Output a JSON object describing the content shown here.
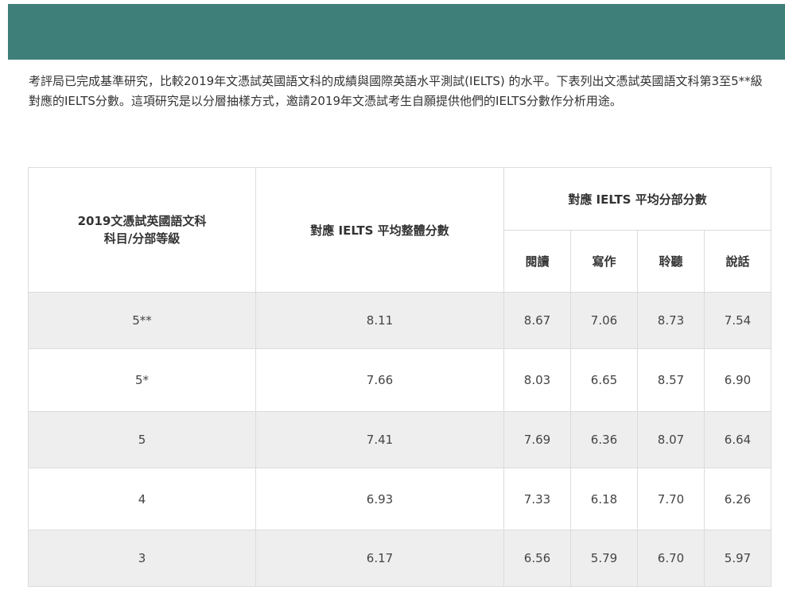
{
  "intro_text": "考評局已完成基準研究，比較2019年文憑試英國語文科的成績與國際英語水平測試(IELTS) 的水平。下表列出文憑試英國語文科第3至5**級對應的IELTS分數。這項研究是以分層抽樣方式，邀請2019年文憑試考生自願提供他們的IELTS分數作分析用途。",
  "table": {
    "col_subject": "2019文憑試英國語文科科目/分部等級",
    "col_subject_line1": "2019文憑試英國語文科",
    "col_subject_line2": "科目/分部等級",
    "col_overall": "對應 IELTS 平均整體分數",
    "col_components": "對應 IELTS 平均分部分數",
    "sub_cols": [
      "閱讀",
      "寫作",
      "聆聽",
      "說話"
    ],
    "rows": [
      {
        "level": "5**",
        "overall": "8.11",
        "reading": "8.67",
        "writing": "7.06",
        "listening": "8.73",
        "speaking": "7.54"
      },
      {
        "level": "5*",
        "overall": "7.66",
        "reading": "8.03",
        "writing": "6.65",
        "listening": "8.57",
        "speaking": "6.90"
      },
      {
        "level": "5",
        "overall": "7.41",
        "reading": "7.69",
        "writing": "6.36",
        "listening": "8.07",
        "speaking": "6.64"
      },
      {
        "level": "4",
        "overall": "6.93",
        "reading": "7.33",
        "writing": "6.18",
        "listening": "7.70",
        "speaking": "6.26"
      },
      {
        "level": "3",
        "overall": "6.17",
        "reading": "6.56",
        "writing": "5.79",
        "listening": "6.70",
        "speaking": "5.97"
      }
    ]
  },
  "colors": {
    "banner": "#3f7f7a",
    "row_shade": "#eeeeee",
    "border": "#dcdcdc"
  }
}
